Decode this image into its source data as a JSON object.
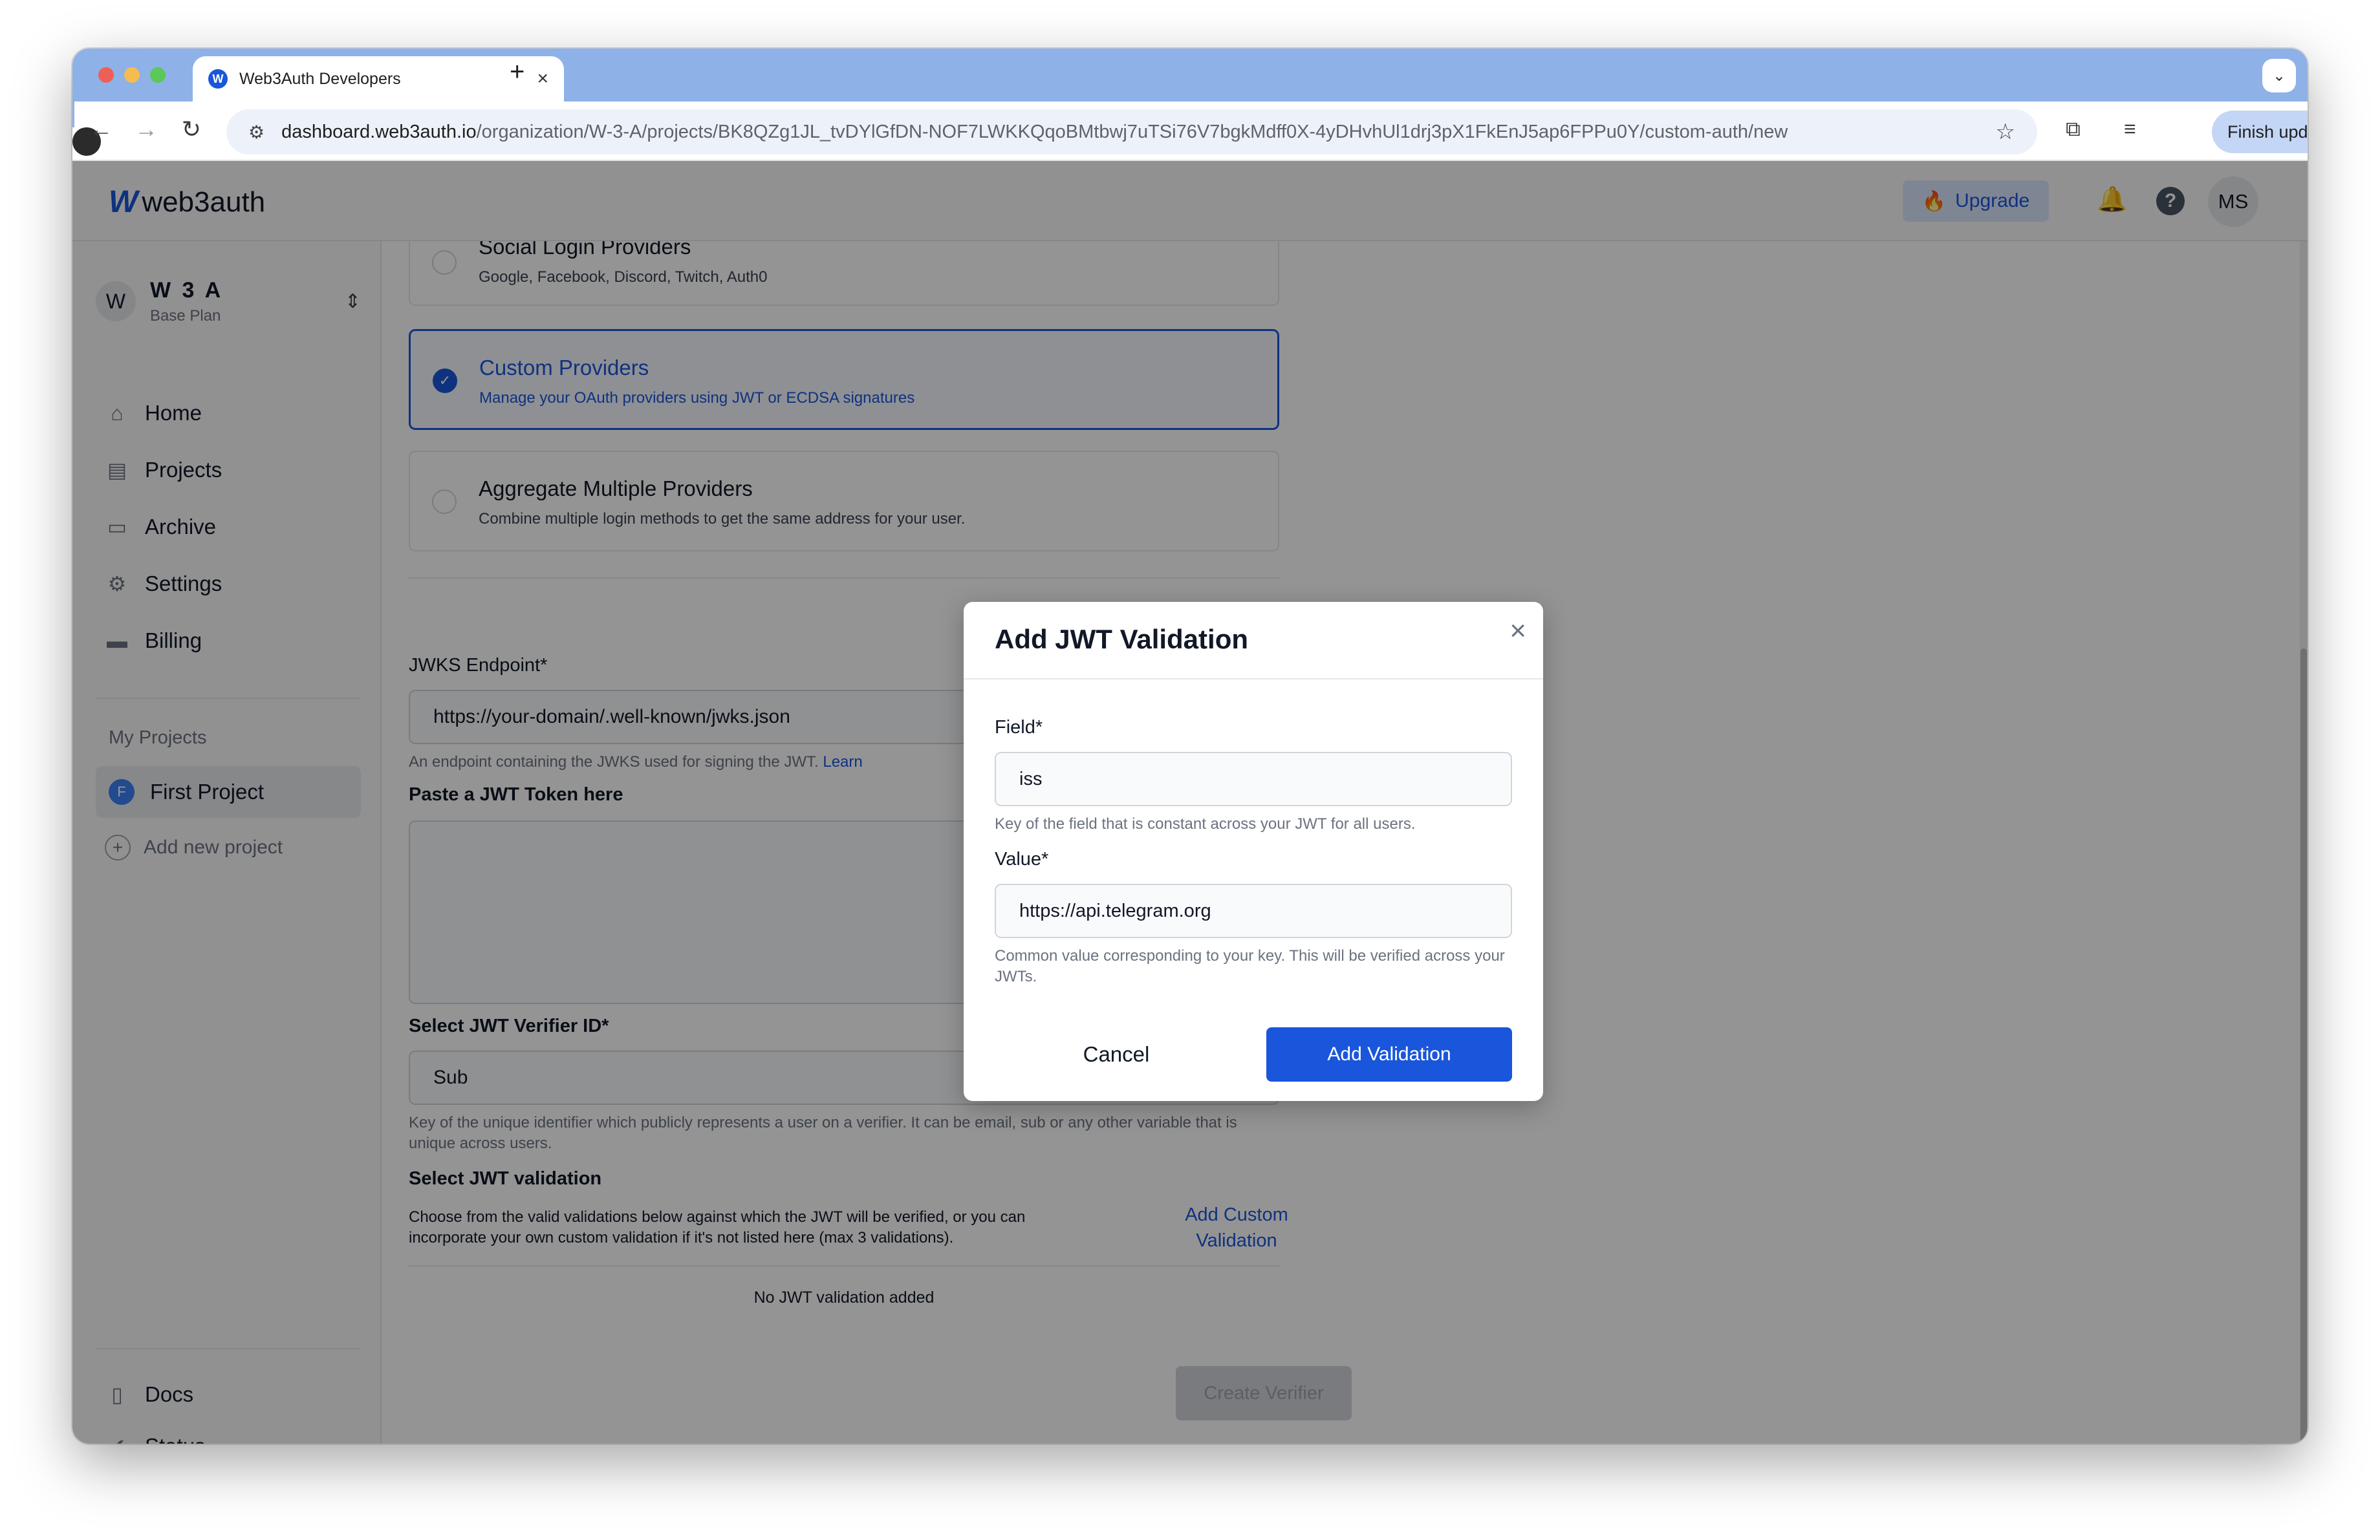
{
  "browser": {
    "tab_title": "Web3Auth Developers",
    "tab_favicon": "W",
    "url_host": "dashboard.web3auth.io",
    "url_path": "/organization/W-3-A/projects/BK8QZg1JL_tvDYlGfDN-NOF7LWKKQqoBMtbwj7uTSi76V7bgkMdff0X-4yDHvhUl1drj3pX1FkEnJ5ap6FPPu0Y/custom-auth/new",
    "finish_update_label": "Finish update"
  },
  "header": {
    "logo_text": "web3auth",
    "upgrade_label": "Upgrade",
    "avatar_initials": "MS"
  },
  "sidebar": {
    "org_initial": "W",
    "org_name": "W 3 A",
    "org_plan": "Base Plan",
    "nav": [
      {
        "label": "Home",
        "icon": "home-icon"
      },
      {
        "label": "Projects",
        "icon": "projects-icon"
      },
      {
        "label": "Archive",
        "icon": "archive-icon"
      },
      {
        "label": "Settings",
        "icon": "gear-icon"
      },
      {
        "label": "Billing",
        "icon": "billing-icon"
      }
    ],
    "my_projects_label": "My Projects",
    "project_initial": "F",
    "project_name": "First Project",
    "add_project_label": "Add new project",
    "bottom_nav": [
      {
        "label": "Docs",
        "icon": "docs-icon"
      },
      {
        "label": "Status",
        "icon": "status-icon"
      }
    ]
  },
  "main": {
    "providers": [
      {
        "title": "Social Login Providers",
        "subtitle": "Google, Facebook, Discord, Twitch, Auth0",
        "selected": false
      },
      {
        "title": "Custom Providers",
        "subtitle": "Manage your OAuth providers using JWT or ECDSA signatures",
        "selected": true
      },
      {
        "title": "Aggregate Multiple Providers",
        "subtitle": "Combine multiple login methods to get the same address for your user.",
        "selected": false
      }
    ],
    "jwks_label": "JWKS Endpoint*",
    "jwks_value": "https://your-domain/.well-known/jwks.json",
    "jwks_help": "An endpoint containing the JWKS used for signing the JWT. ",
    "jwks_help_link": "Learn",
    "jwt_token_label": "Paste a JWT Token here",
    "verifier_id_label": "Select JWT Verifier ID*",
    "verifier_id_value": "Sub",
    "verifier_id_help": "Key of the unique identifier which publicly represents a user on a verifier. It can be email, sub or any other variable that is unique across users.",
    "validation_label": "Select JWT validation",
    "validation_help": "Choose from the valid validations below against which the JWT will be verified, or you can incorporate your own custom validation if it's not listed here (max 3 validations).",
    "add_custom_validation_label": "Add Custom Validation",
    "empty_validation": "No JWT validation added",
    "create_verifier_label": "Create Verifier"
  },
  "modal": {
    "title": "Add JWT Validation",
    "field_label": "Field*",
    "field_value": "iss",
    "field_help": "Key of the field that is constant across your JWT for all users.",
    "value_label": "Value*",
    "value_value": "https://api.telegram.org",
    "value_help": "Common value corresponding to your key. This will be verified across your JWTs.",
    "cancel_label": "Cancel",
    "add_label": "Add Validation"
  },
  "colors": {
    "accent": "#1a56db",
    "tabstrip": "#8eb1e8"
  }
}
